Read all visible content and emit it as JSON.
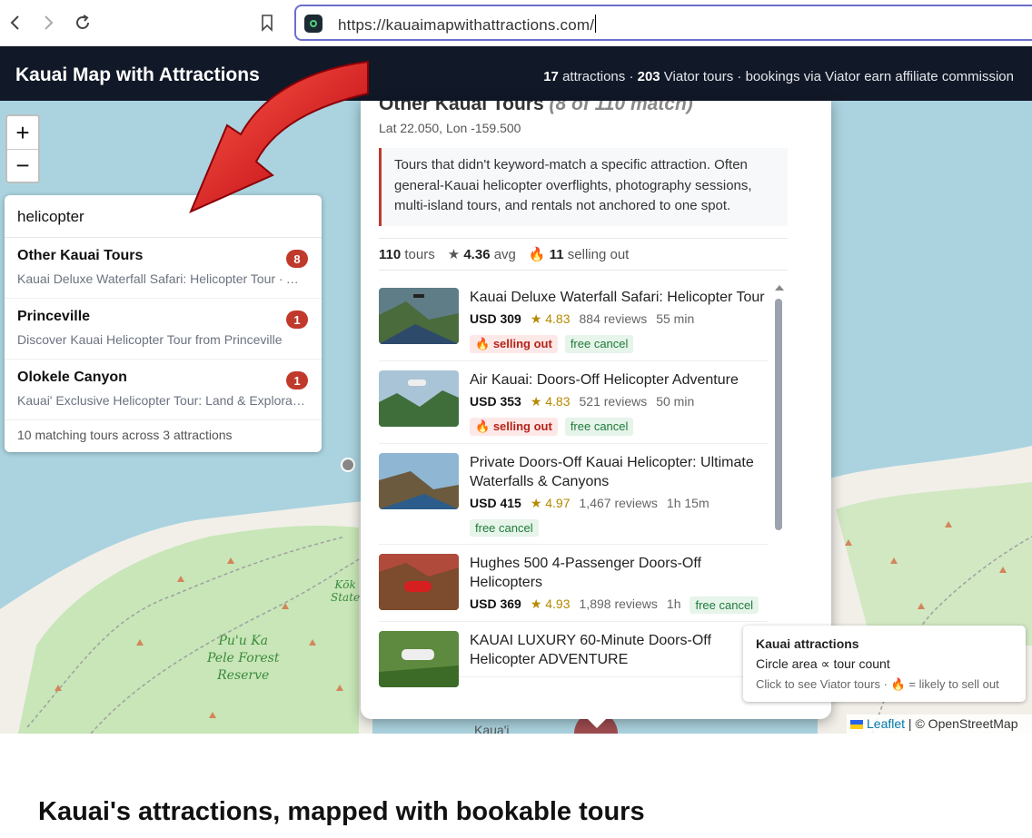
{
  "browser": {
    "url": "https://kauaimapwithattractions.com/",
    "icons": {
      "back": "arrow-left-icon",
      "forward": "arrow-right-icon",
      "reload": "reload-icon",
      "bookmark": "bookmark-icon",
      "site": "site-favicon-icon"
    }
  },
  "header": {
    "title": "Kauai Map with Attractions",
    "stats": {
      "attractions_count": "17",
      "attractions_label": " attractions · ",
      "tours_count": "203",
      "tours_label": " Viator tours · bookings via Viator earn affiliate commission"
    }
  },
  "map": {
    "zoom_in": "+",
    "zoom_out": "−",
    "labels": {
      "forest_reserve": [
        "Pu'u Ka",
        "Pele Forest",
        "Reserve"
      ],
      "state": [
        "Kōk",
        "State"
      ],
      "bottom": "Kaua'i"
    },
    "attribution": {
      "link": "Leaflet",
      "separator": " | ",
      "osm": "© OpenStreetMap"
    }
  },
  "search": {
    "query": "helicopter",
    "results": [
      {
        "title": "Other Kauai Tours",
        "count": "8",
        "subtitle": "Kauai Deluxe Waterfall Safari: Helicopter Tour · Air Kauai"
      },
      {
        "title": "Princeville",
        "count": "1",
        "subtitle": "Discover Kauai Helicopter Tour from Princeville"
      },
      {
        "title": "Olokele Canyon",
        "count": "1",
        "subtitle": "Kauai' Exclusive Helicopter Tour: Land & Exploration"
      }
    ],
    "footer": "10 matching tours across 3 attractions"
  },
  "popup": {
    "title": "Other Kauai Tours",
    "title_match": "(8 of 110 match)",
    "coords": "Lat 22.050, Lon -159.500",
    "description": "Tours that didn't keyword-match a specific attraction. Often general-Kauai helicopter overflights, photography sessions, multi-island tours, and rentals not anchored to one spot.",
    "stats": {
      "tours_count": "110",
      "tours_label": " tours",
      "avg_value": "4.36",
      "avg_label": " avg",
      "selling_value": "11",
      "selling_label": " selling out"
    },
    "tours": [
      {
        "title": "Kauai Deluxe Waterfall Safari: Helicopter Tour",
        "price": "USD 309",
        "rating": "★ 4.83",
        "reviews": "884 reviews",
        "duration": "55 min",
        "selling_out": "selling out",
        "free_cancel": "free cancel"
      },
      {
        "title": "Air Kauai: Doors-Off Helicopter Adventure",
        "price": "USD 353",
        "rating": "★ 4.83",
        "reviews": "521 reviews",
        "duration": "50 min",
        "selling_out": "selling out",
        "free_cancel": "free cancel"
      },
      {
        "title": "Private Doors-Off Kauai Helicopter: Ultimate Waterfalls & Canyons",
        "price": "USD 415",
        "rating": "★ 4.97",
        "reviews": "1,467 reviews",
        "duration": "1h 15m",
        "selling_out": "",
        "free_cancel": "free cancel"
      },
      {
        "title": "Hughes 500 4-Passenger Doors-Off Helicopters",
        "price": "USD 369",
        "rating": "★ 4.93",
        "reviews": "1,898 reviews",
        "duration": "1h",
        "selling_out": "",
        "free_cancel": "free cancel"
      },
      {
        "title": "KAUAI LUXURY 60-Minute Doors-Off Helicopter ADVENTURE",
        "price": "",
        "rating": "",
        "reviews": "",
        "duration": "",
        "selling_out": "",
        "free_cancel": ""
      }
    ]
  },
  "legend": {
    "title": "Kauai attractions",
    "line": "Circle area ∝ tour count",
    "hint_before": "Click to see Viator tours · ",
    "hint_after": " = likely to sell out"
  },
  "section": {
    "title": "Kauai's attractions, mapped with bookable tours"
  },
  "colors": {
    "header_bg": "#111827",
    "accent_red": "#c0392b",
    "map_water": "#aad3df",
    "map_land": "#f2efe9",
    "forest": "#c8e6b8",
    "url_border": "#6b6fce"
  }
}
